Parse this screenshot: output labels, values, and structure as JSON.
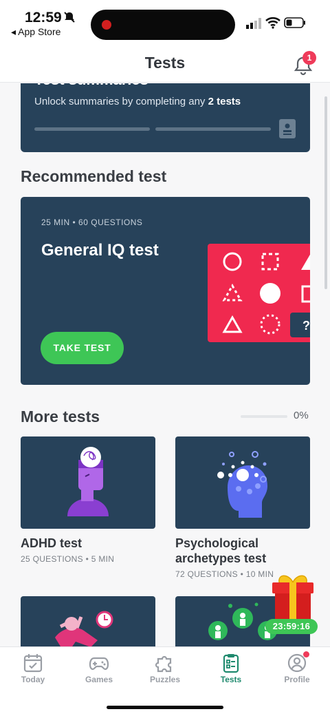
{
  "status_bar": {
    "time": "12:59",
    "back_label": "◂ App Store"
  },
  "header": {
    "title": "Tests",
    "notification_count": "1"
  },
  "summary_card": {
    "title": "Test summaries",
    "text_prefix": "Unlock summaries by completing any ",
    "text_bold": "2 tests",
    "progress_segments": [
      0,
      0
    ]
  },
  "recommended": {
    "heading": "Recommended test",
    "meta": "25 MIN • 60 QUESTIONS",
    "title": "General IQ test",
    "button": "TAKE TEST",
    "puzzle_mark": "?"
  },
  "more_tests": {
    "heading": "More tests",
    "progress_label": "0%",
    "progress": 0,
    "items": [
      {
        "title": "ADHD test",
        "meta": "25 QUESTIONS • 5 MIN"
      },
      {
        "title": "Psychological archetypes test",
        "meta": "72 QUESTIONS • 10 MIN"
      }
    ]
  },
  "gift": {
    "timer": "23:59:16"
  },
  "tabs": [
    {
      "label": "Today",
      "icon": "calendar-icon"
    },
    {
      "label": "Games",
      "icon": "gamepad-icon"
    },
    {
      "label": "Puzzles",
      "icon": "puzzle-icon"
    },
    {
      "label": "Tests",
      "icon": "clipboard-icon",
      "active": true
    },
    {
      "label": "Profile",
      "icon": "profile-icon"
    }
  ],
  "colors": {
    "card": "#27425a",
    "accent_green": "#3ec656",
    "puzzle_pink": "#f0294f",
    "tab_active": "#1f8a6e"
  }
}
